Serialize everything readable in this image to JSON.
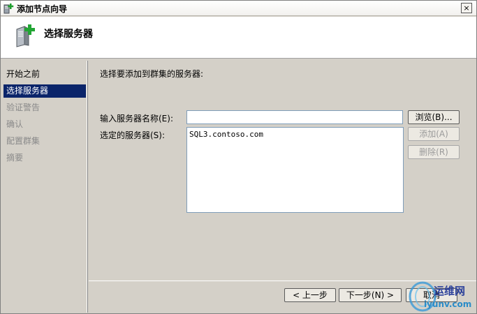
{
  "window": {
    "title": "添加节点向导",
    "close_label": "×"
  },
  "header": {
    "title": "选择服务器"
  },
  "nav": {
    "items": [
      {
        "label": "开始之前"
      },
      {
        "label": "选择服务器"
      },
      {
        "label": "验证警告"
      },
      {
        "label": "确认"
      },
      {
        "label": "配置群集"
      },
      {
        "label": "摘要"
      }
    ]
  },
  "main": {
    "prompt": "选择要添加到群集的服务器:",
    "server_name_label": "输入服务器名称(E):",
    "server_name_value": "",
    "selected_label": "选定的服务器(S):",
    "selected_servers": [
      "SQL3.contoso.com"
    ],
    "browse_button": "浏览(B)...",
    "add_button": "添加(A)",
    "remove_button": "删除(R)"
  },
  "footer": {
    "back_button": "< 上一步",
    "next_button": "下一步(N) >",
    "cancel_button": "取消"
  },
  "watermark": {
    "line1": "运维网",
    "line2": "iyunv.com"
  },
  "colors": {
    "selection": "#0a246a",
    "disabled_text": "#8a8a8a",
    "background": "#d4d0c8"
  },
  "icons": {
    "title": "wizard-add-icon",
    "header": "server-add-icon",
    "close": "close-icon"
  }
}
